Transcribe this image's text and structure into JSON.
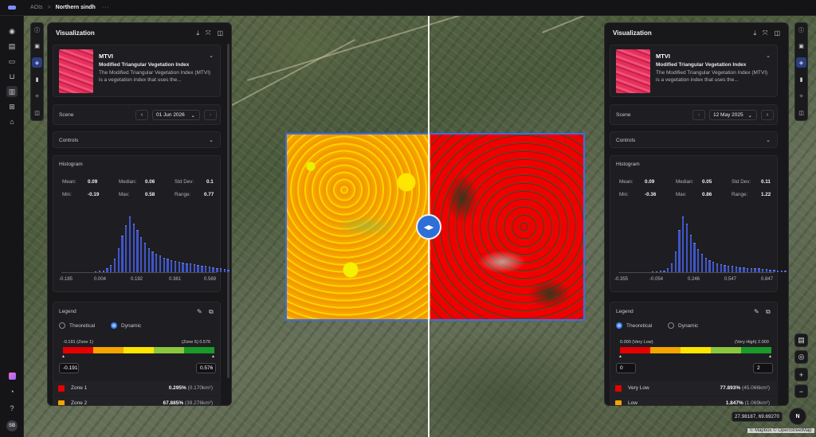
{
  "breadcrumb": {
    "root": "AOIs",
    "separator": ">",
    "current": "Northern sindh",
    "more": "···"
  },
  "nav_icons": [
    "compass-icon",
    "folder-icon",
    "truck-icon",
    "cart-icon",
    "map-icon",
    "workflow-icon",
    "store-icon",
    "app-icon",
    "bell-icon",
    "help-icon"
  ],
  "user": {
    "initials": "SB"
  },
  "left": {
    "title": "Visualization",
    "index": {
      "code": "MTVI",
      "name": "Modified Triangular Vegetation Index",
      "description": "The Modified Triangular Vegetation Index (MTVI) is a vegetation index that uses the..."
    },
    "scene_label": "Scene",
    "scene_date": "01 Jun 2026",
    "controls_label": "Controls",
    "histogram_label": "Histogram",
    "stats": {
      "mean_label": "Mean:",
      "mean": "0.09",
      "median_label": "Median:",
      "median": "0.06",
      "std_label": "Std Dev:",
      "std": "0.1",
      "min_label": "Min:",
      "min": "-0.19",
      "max_label": "Max:",
      "max": "0.58",
      "range_label": "Range:",
      "range": "0.77"
    },
    "histogram": {
      "bins": [
        1,
        2,
        3,
        6,
        12,
        22,
        40,
        60,
        78,
        92,
        80,
        70,
        58,
        48,
        40,
        34,
        30,
        27,
        24,
        22,
        20,
        18,
        17,
        16,
        15,
        14,
        13,
        12,
        11,
        10,
        9,
        8,
        7,
        6,
        5,
        4,
        3,
        2,
        2,
        1,
        1
      ],
      "ticks": [
        "-0.185",
        "0.004",
        "0.192",
        "0.381",
        "0.569"
      ]
    },
    "legend_label": "Legend",
    "legend_modes": {
      "theoretical": "Theoretical",
      "dynamic": "Dynamic",
      "selected": "dynamic"
    },
    "scale_min_label": "-0.191 (Zone 1)",
    "scale_max_label": "(Zone 5) 0.576",
    "input_min": "-0.191",
    "input_max": "0.576",
    "zones": [
      {
        "name": "Zone 1",
        "pct": "0.295%",
        "area": "(0.170km²)",
        "color": "#e60000"
      },
      {
        "name": "Zone 2",
        "pct": "67.885%",
        "area": "(39.276km²)",
        "color": "#f5a400"
      }
    ]
  },
  "right": {
    "title": "Visualization",
    "index": {
      "code": "MTVI",
      "name": "Modified Triangular Vegetation Index",
      "description": "The Modified Triangular Vegetation Index (MTVI) is a vegetation index that uses the..."
    },
    "scene_label": "Scene",
    "scene_date": "12 May 2025",
    "controls_label": "Controls",
    "histogram_label": "Histogram",
    "stats": {
      "mean_label": "Mean:",
      "mean": "0.09",
      "median_label": "Median:",
      "median": "0.05",
      "std_label": "Std Dev:",
      "std": "0.11",
      "min_label": "Min:",
      "min": "-0.36",
      "max_label": "Max:",
      "max": "0.86",
      "range_label": "Range:",
      "range": "1.22"
    },
    "histogram": {
      "bins": [
        1,
        1,
        2,
        3,
        6,
        14,
        34,
        70,
        92,
        80,
        62,
        48,
        38,
        30,
        24,
        20,
        17,
        15,
        13,
        12,
        11,
        10,
        9,
        8,
        8,
        7,
        7,
        6,
        6,
        5,
        5,
        4,
        4,
        3,
        3,
        2,
        2,
        2,
        1,
        1,
        1
      ],
      "ticks": [
        "-0.355",
        "-0.054",
        "0.246",
        "0.547",
        "0.847"
      ]
    },
    "legend_label": "Legend",
    "legend_modes": {
      "theoretical": "Theoretical",
      "dynamic": "Dynamic",
      "selected": "theoretical"
    },
    "scale_min_label": "0.000 (Very Low)",
    "scale_max_label": "(Very High) 2.000",
    "input_min": "0",
    "input_max": "2",
    "zones": [
      {
        "name": "Very Low",
        "pct": "77.893%",
        "area": "(45.066km²)",
        "color": "#e60000"
      },
      {
        "name": "Low",
        "pct": "1.847%",
        "area": "(1.069km²)",
        "color": "#f5a400"
      }
    ]
  },
  "legend_colors": [
    "#e60000",
    "#f5a400",
    "#ffe600",
    "#8cc63f",
    "#1a9a2a"
  ],
  "map": {
    "coords": "27.98187, 69.69270",
    "compass": "N",
    "attribution": "© Mapbox © OpenStreetMap"
  }
}
